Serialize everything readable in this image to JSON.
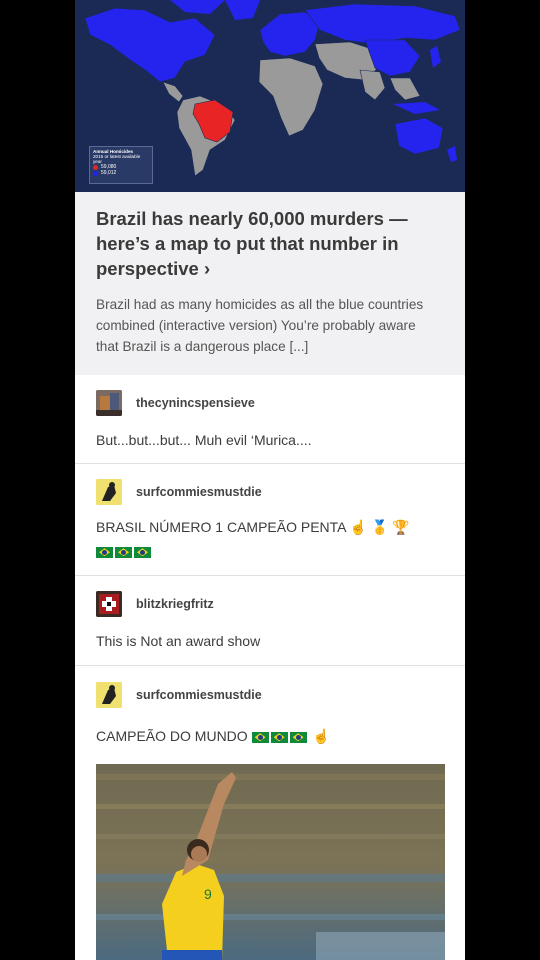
{
  "map": {
    "legend_title": "Annual Homicides",
    "legend_subtitle": "2015 or latest available year",
    "legend_items": [
      {
        "label": "59,080",
        "color": "#e02626"
      },
      {
        "label": "59,012",
        "color": "#2222ee"
      }
    ],
    "colors": {
      "ocean": "#1b2a55",
      "blue": "#2424ee",
      "red": "#e82424",
      "gray": "#9a9a9a"
    }
  },
  "link": {
    "title": "Brazil has nearly 60,000 murders — here’s a map to put that number in perspective ›",
    "description": "Brazil had as many homicides as all the blue countries combined (interactive version) You’re probably aware that Brazil is a dangerous place [...]"
  },
  "reblogs": [
    {
      "username": "thecynincspensieve",
      "text": "But...but...but... Muh evil ‘Murica...."
    },
    {
      "username": "surfcommiesmustdie",
      "text": "BRASIL NÚMERO 1 CAMPEÃO PENTA",
      "emoji": [
        "finger-up-emoji",
        "medal-emoji",
        "trophy-emoji"
      ],
      "flags": 3
    },
    {
      "username": "blitzkriegfritz",
      "text": "This is Not an award show"
    },
    {
      "username": "surfcommiesmustdie",
      "text": "CAMPEÃO DO MUNDO",
      "flags": 3,
      "emoji": [
        "finger-up-emoji"
      ]
    }
  ]
}
